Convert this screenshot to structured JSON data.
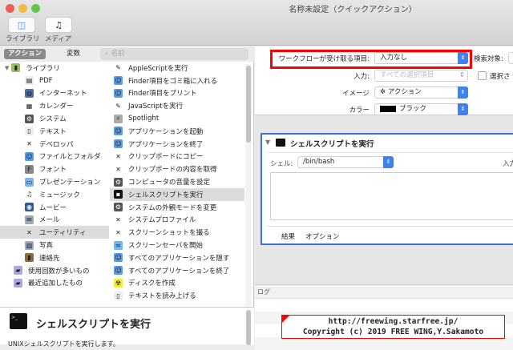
{
  "window": {
    "title": "名称未設定（クイックアクション）"
  },
  "toolbar": {
    "library_label": "ライブラリ",
    "media_label": "メディア"
  },
  "tabs": {
    "actions": "アクション",
    "variables": "変数",
    "search_placeholder": "名前"
  },
  "library": [
    {
      "label": "ライブラリ",
      "icon": "library-icon"
    },
    {
      "label": "PDF",
      "icon": "pdf-icon"
    },
    {
      "label": "インターネット",
      "icon": "internet-icon"
    },
    {
      "label": "カレンダー",
      "icon": "calendar-icon"
    },
    {
      "label": "システム",
      "icon": "system-icon"
    },
    {
      "label": "テキスト",
      "icon": "text-icon"
    },
    {
      "label": "デベロッパ",
      "icon": "developer-icon"
    },
    {
      "label": "ファイルとフォルダ",
      "icon": "finder-icon"
    },
    {
      "label": "フォント",
      "icon": "font-icon"
    },
    {
      "label": "プレゼンテーション",
      "icon": "presentation-icon"
    },
    {
      "label": "ミュージック",
      "icon": "music-icon"
    },
    {
      "label": "ムービー",
      "icon": "movie-icon"
    },
    {
      "label": "メール",
      "icon": "mail-icon"
    },
    {
      "label": "ユーティリティ",
      "icon": "utility-icon",
      "selected": true
    },
    {
      "label": "写真",
      "icon": "photo-icon"
    },
    {
      "label": "連絡先",
      "icon": "contacts-icon"
    },
    {
      "label": "使用回数が多いもの",
      "icon": "smart-folder-icon"
    },
    {
      "label": "最近追加したもの",
      "icon": "smart-folder-icon"
    }
  ],
  "actions": [
    {
      "label": "AppleScriptを実行",
      "icon": "script-icon"
    },
    {
      "label": "Finder項目をゴミ箱に入れる",
      "icon": "finder-icon"
    },
    {
      "label": "Finder項目をプリント",
      "icon": "finder-icon"
    },
    {
      "label": "JavaScriptを実行",
      "icon": "script-icon"
    },
    {
      "label": "Spotlight",
      "icon": "spotlight-icon"
    },
    {
      "label": "アプリケーションを起動",
      "icon": "finder-icon"
    },
    {
      "label": "アプリケーションを終了",
      "icon": "finder-icon"
    },
    {
      "label": "クリップボードにコピー",
      "icon": "utility-icon"
    },
    {
      "label": "クリップボードの内容を取得",
      "icon": "utility-icon"
    },
    {
      "label": "コンピュータの音量を設定",
      "icon": "system-icon"
    },
    {
      "label": "シェルスクリプトを実行",
      "icon": "terminal-icon",
      "selected": true
    },
    {
      "label": "システムの外観モードを変更",
      "icon": "system-icon"
    },
    {
      "label": "システムプロファイル",
      "icon": "utility-icon"
    },
    {
      "label": "スクリーンショットを撮る",
      "icon": "utility-icon"
    },
    {
      "label": "スクリーンセーバを開始",
      "icon": "screensaver-icon"
    },
    {
      "label": "すべてのアプリケーションを隠す",
      "icon": "finder-icon"
    },
    {
      "label": "すべてのアプリケーションを終了",
      "icon": "finder-icon"
    },
    {
      "label": "ディスクを作成",
      "icon": "burn-icon"
    },
    {
      "label": "テキストを読み上げる",
      "icon": "text-icon"
    }
  ],
  "description": {
    "title": "シェルスクリプトを実行",
    "body": "UNIXシェルスクリプトを実行します。"
  },
  "settings": {
    "workflow_receives_label": "ワークフローが受け取る項目:",
    "workflow_receives_value": "入力なし",
    "search_target_label": "検索対象:",
    "input_label": "入力:",
    "input_value": "すべての選択項目",
    "selected_checkbox_label": "選択さ",
    "image_label": "イメージ",
    "image_value": "アクション",
    "color_label": "カラー",
    "color_value": "ブラック",
    "color_swatch": "#000000"
  },
  "action_box": {
    "title": "シェルスクリプトを実行",
    "shell_label": "シェル:",
    "shell_value": "/bin/bash",
    "input_label": "入力",
    "tab_results": "結果",
    "tab_options": "オプション"
  },
  "log": {
    "label": "ログ"
  },
  "watermark": {
    "line1": "http://freewing.starfree.jp/",
    "line2": "Copyright (c) 2019 FREE WING,Y.Sakamoto"
  },
  "colors": {
    "accent": "#3d82f0",
    "highlight_box": "#ff0000",
    "selection": "#dcdcdc"
  }
}
